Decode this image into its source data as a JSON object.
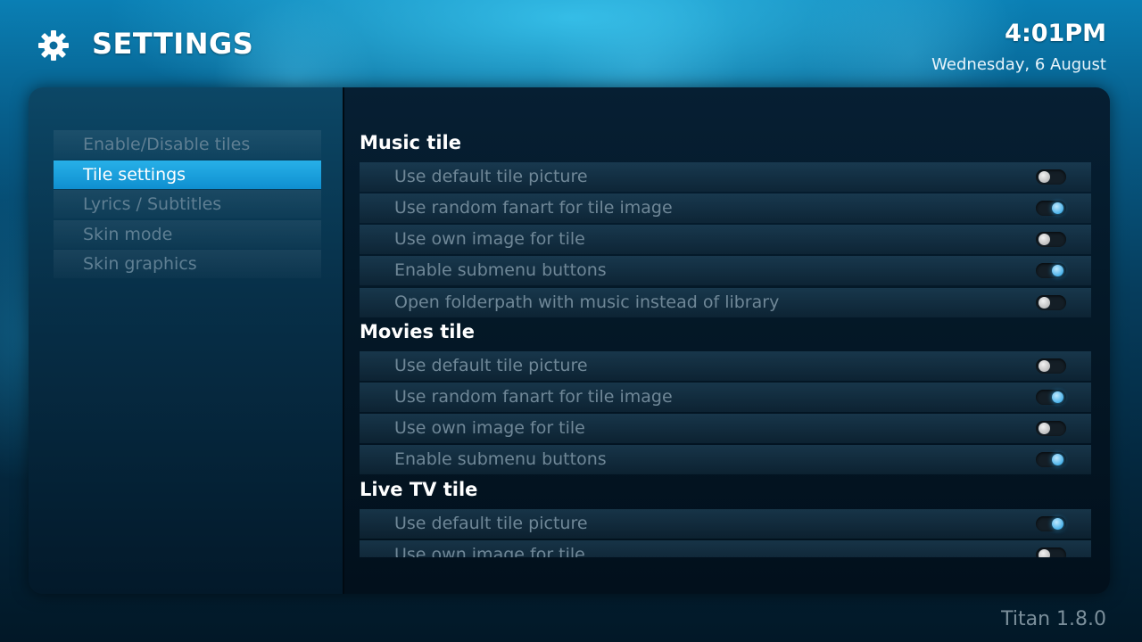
{
  "header": {
    "title": "SETTINGS",
    "icon": "gear-icon"
  },
  "clock": {
    "time": "4:01PM",
    "date": "Wednesday, 6 August"
  },
  "sidebar": {
    "items": [
      {
        "label": "Enable/Disable tiles",
        "active": false
      },
      {
        "label": "Tile settings",
        "active": true
      },
      {
        "label": "Lyrics / Subtitles",
        "active": false
      },
      {
        "label": "Skin mode",
        "active": false
      },
      {
        "label": "Skin graphics",
        "active": false
      }
    ]
  },
  "sections": [
    {
      "title": "Music tile",
      "rows": [
        {
          "label": "Use default tile picture",
          "enabled": false
        },
        {
          "label": "Use random fanart for tile image",
          "enabled": true
        },
        {
          "label": "Use own image for tile",
          "enabled": false
        },
        {
          "label": "Enable submenu buttons",
          "enabled": true
        },
        {
          "label": "Open folderpath with music instead of library",
          "enabled": false
        }
      ]
    },
    {
      "title": "Movies tile",
      "rows": [
        {
          "label": "Use default tile picture",
          "enabled": false
        },
        {
          "label": "Use random fanart for tile image",
          "enabled": true
        },
        {
          "label": "Use own image for tile",
          "enabled": false
        },
        {
          "label": "Enable submenu buttons",
          "enabled": true
        }
      ]
    },
    {
      "title": "Live TV tile",
      "rows": [
        {
          "label": "Use default tile picture",
          "enabled": true
        },
        {
          "label": "Use own image for tile",
          "enabled": false
        }
      ]
    }
  ],
  "footer": {
    "version": "Titan 1.8.0"
  },
  "colors": {
    "accent": "#1a9be0",
    "active_item": "#27b0e8"
  }
}
